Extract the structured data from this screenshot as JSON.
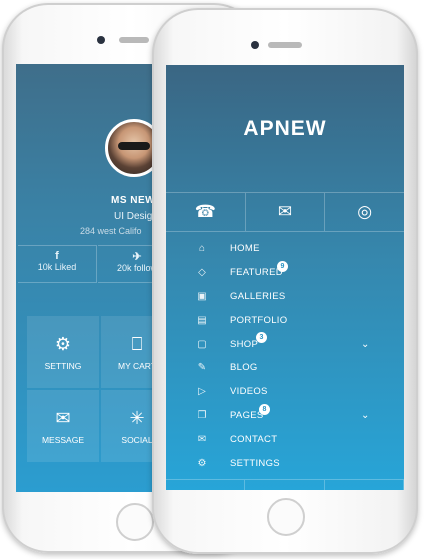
{
  "back_screen": {
    "profile": {
      "name": "MS NEWA",
      "role": "UI Design",
      "address": "284 west Califo"
    },
    "stats": [
      {
        "icon": "facebook-icon",
        "glyph": "f",
        "label": "10k Liked"
      },
      {
        "icon": "twitter-icon",
        "glyph": "✈",
        "label": "20k follow"
      }
    ],
    "tiles": [
      {
        "icon": "gear-icon",
        "glyph": "⚙",
        "label": "SETTING"
      },
      {
        "icon": "cart-icon",
        "glyph": "⎕",
        "label": "MY CART"
      },
      {
        "icon": "envelope-icon",
        "glyph": "✉",
        "label": "MESSAGE"
      },
      {
        "icon": "share-icon",
        "glyph": "✳",
        "label": "SOCIAL"
      }
    ]
  },
  "front_screen": {
    "title": "APNEW",
    "icon_bar": [
      {
        "icon": "phone-icon",
        "glyph": "☎"
      },
      {
        "icon": "mail-open-icon",
        "glyph": "✉"
      },
      {
        "icon": "globe-icon",
        "glyph": "◎"
      }
    ],
    "menu": [
      {
        "icon": "home-icon",
        "glyph": "⌂",
        "label": "HOME",
        "badge": "",
        "expandable": false
      },
      {
        "icon": "diamond-icon",
        "glyph": "◇",
        "label": "FEATURED",
        "badge": "9",
        "expandable": false
      },
      {
        "icon": "image-icon",
        "glyph": "▣",
        "label": "GALLERIES",
        "badge": "",
        "expandable": false
      },
      {
        "icon": "briefcase-icon",
        "glyph": "▤",
        "label": "PORTFOLIO",
        "badge": "",
        "expandable": false
      },
      {
        "icon": "bag-icon",
        "glyph": "▢",
        "label": "SHOP",
        "badge": "3",
        "expandable": true
      },
      {
        "icon": "edit-icon",
        "glyph": "✎",
        "label": "BLOG",
        "badge": "",
        "expandable": false
      },
      {
        "icon": "video-icon",
        "glyph": "▷",
        "label": "VIDEOS",
        "badge": "",
        "expandable": false
      },
      {
        "icon": "pages-icon",
        "glyph": "❐",
        "label": "PAGES",
        "badge": "8",
        "expandable": true
      },
      {
        "icon": "envelope-icon",
        "glyph": "✉",
        "label": "CONTACT",
        "badge": "",
        "expandable": false
      },
      {
        "icon": "gear-icon",
        "glyph": "⚙",
        "label": "SETTINGS",
        "badge": "",
        "expandable": false
      }
    ],
    "chevron_glyph": "⌄"
  }
}
